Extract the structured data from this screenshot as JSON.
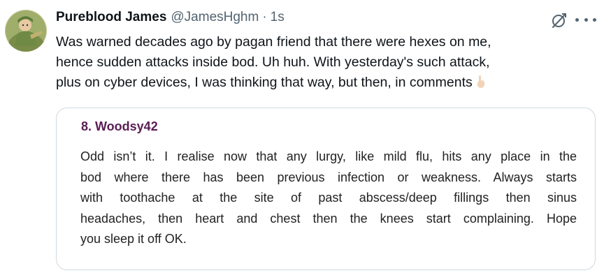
{
  "tweet": {
    "display_name": "Pureblood James",
    "handle": "@JamesHghm",
    "separator": "·",
    "time": "1s",
    "body_lines": [
      "Was warned decades ago by pagan friend that there were hexes on me,",
      "hence sudden attacks inside bod. Uh huh. With yesterday's such attack,",
      "plus on cyber devices, I  was thinking that way, but then, in comments"
    ],
    "trailing_emoji": "pointing-down-hand-icon"
  },
  "quote": {
    "author": "8. Woodsy42",
    "lines": [
      "Odd isn’t it. I realise now that any lurgy, like mild flu, hits any place in the",
      "bod where there has been previous infection or weakness. Always starts",
      "with toothache at the site of past abscess/deep fillings then sinus",
      "headaches, then heart and chest then the knees start complaining. Hope",
      "you sleep it off OK."
    ]
  },
  "colors": {
    "text": "#0f1419",
    "secondary": "#536471",
    "card_border": "#cfd9de",
    "quote_author": "#5b1e54"
  }
}
